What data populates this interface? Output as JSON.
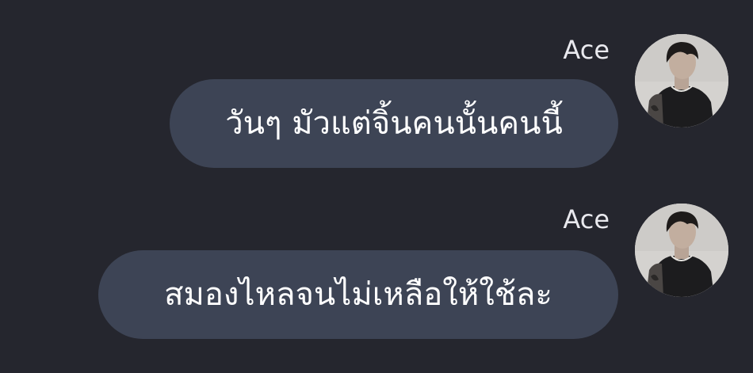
{
  "chat": {
    "messages": [
      {
        "sender": "Ace",
        "text": "วันๆ มัวแต่จิ้นคนนั้นคนนี้",
        "avatar": "user-avatar-photo"
      },
      {
        "sender": "Ace",
        "text": "สมองไหลจนไม่เหลือให้ใช้ละ",
        "avatar": "user-avatar-photo"
      }
    ]
  },
  "colors": {
    "background": "#25262e",
    "bubble": "#3d4455",
    "sender_text": "#e9e9ee",
    "message_text": "#ffffff"
  }
}
